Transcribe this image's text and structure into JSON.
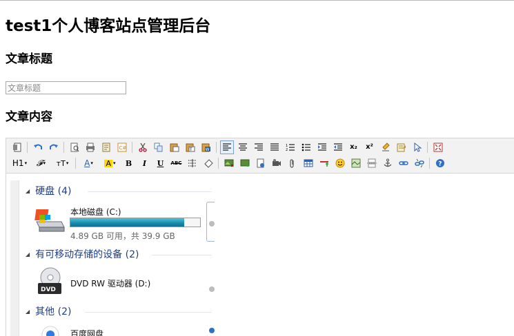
{
  "page": {
    "title": "test1个人博客站点管理后台",
    "article_title_label": "文章标题",
    "article_title_input": {
      "placeholder": "文章标题",
      "value": ""
    },
    "article_content_label": "文章内容"
  },
  "toolbar": {
    "row1": [
      "source-icon",
      "undo-icon",
      "redo-icon",
      "preview-icon",
      "print-icon",
      "template-icon",
      "code-icon",
      "cut-icon",
      "copy-icon",
      "paste-icon",
      "paste-text-icon",
      "paste-word-icon",
      "align-left-icon",
      "align-center-icon",
      "align-right-icon",
      "align-justify-icon",
      "ordered-list-icon",
      "unordered-list-icon",
      "indent-icon",
      "outdent-icon",
      "subscript-icon",
      "superscript-icon",
      "clear-format-icon",
      "select-all-icon",
      "cursor-icon",
      "fullscreen-icon"
    ],
    "row2": [
      "heading-menu",
      "font-family-menu",
      "font-size-menu",
      "font-color-menu",
      "highlight-color-menu",
      "bold-icon",
      "italic-icon",
      "underline-icon",
      "strikethrough-icon",
      "line-height-icon",
      "eraser-icon",
      "image-icon",
      "multi-image-icon",
      "flash-icon",
      "media-icon",
      "attachment-icon",
      "table-icon",
      "horizontal-rule-icon",
      "emoticon-icon",
      "baidu-map-icon",
      "page-break-icon",
      "anchor-icon",
      "link-icon",
      "unlink-icon",
      "help-icon"
    ],
    "labels": {
      "heading": "H1",
      "font_family": "𝓕",
      "font_size": "тT",
      "font_color": "A",
      "highlight": "A",
      "bold": "B",
      "italic": "I",
      "underline": "U",
      "strikethrough": "ABC",
      "subscript": "x₂",
      "superscript": "x²"
    },
    "active": "align-left-icon"
  },
  "content_image": {
    "groups": [
      {
        "label": "硬盘 (4)"
      },
      {
        "label": "有可移动存储的设备 (2)"
      },
      {
        "label": "其他 (2)"
      }
    ],
    "devices": [
      {
        "name": "本地磁盘 (C:)",
        "detail": "4.89 GB 可用，共 39.9 GB",
        "used_fraction": 0.877
      },
      {
        "name": "DVD RW 驱动器 (D:)",
        "icon_label": "DVD"
      },
      {
        "name": "百度网盘"
      }
    ]
  },
  "colors": {
    "group_text": "#1e3d8c",
    "toolbar_bg": "#f2f2f2",
    "progress_fill": "#1a8db0"
  }
}
